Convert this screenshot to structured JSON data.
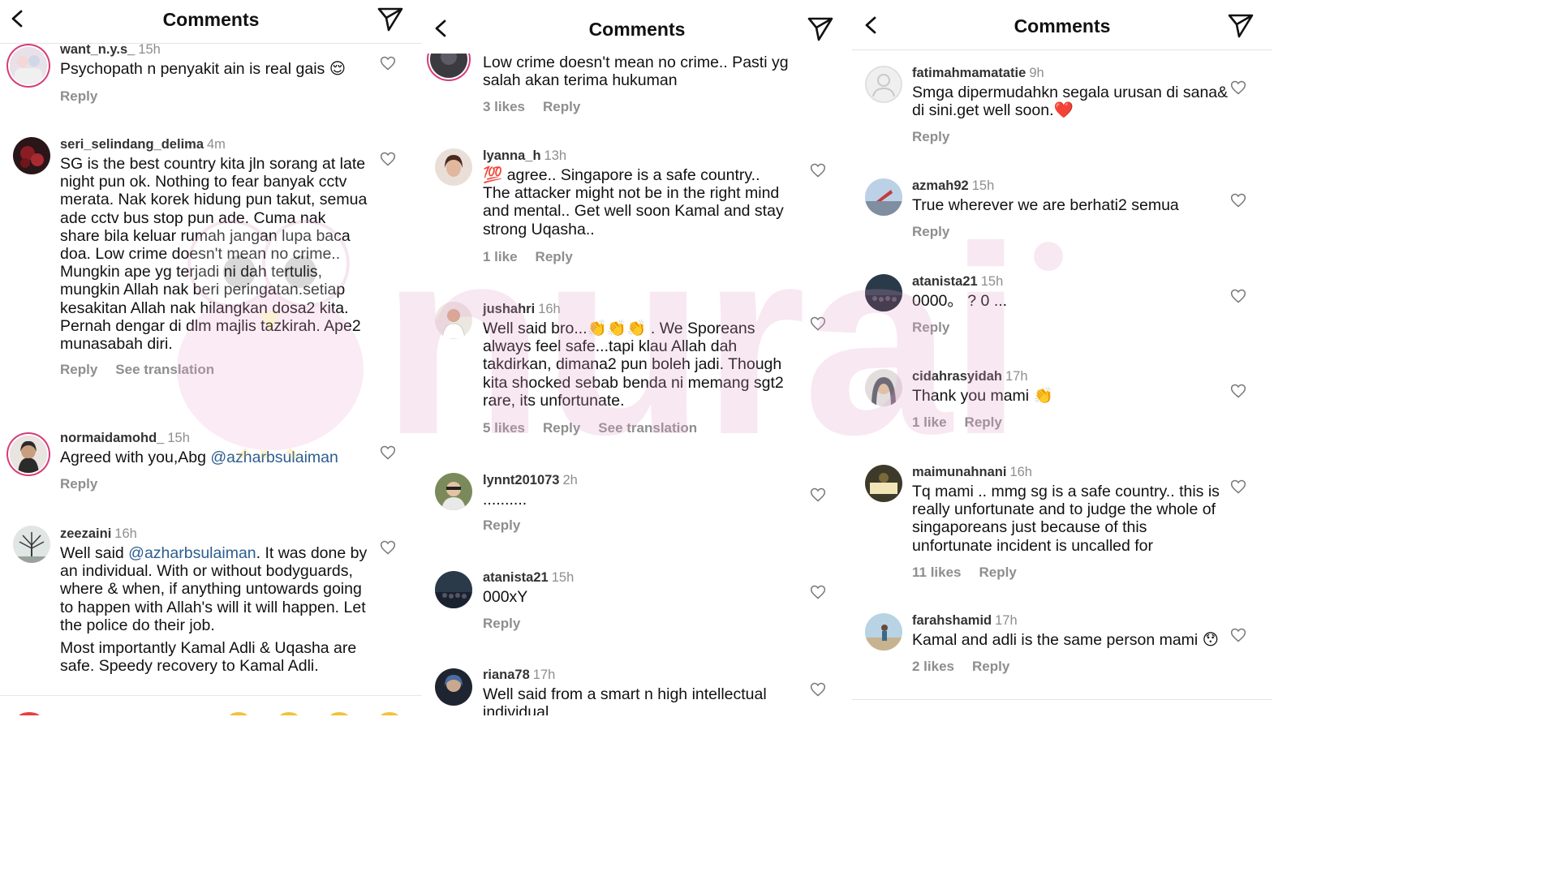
{
  "panels": [
    {
      "title": "Comments",
      "comments": [
        {
          "user": "want_n.y.s_",
          "time": "15h",
          "text": "Psychopath n penyakit ain is real gais 😌",
          "meta": [
            "Reply"
          ]
        },
        {
          "user": "seri_selindang_delima",
          "time": "4m",
          "text": "SG is the best country kita jln sorang at late night pun ok. Nothing to fear banyak cctv merata. Nak korek hidung pun takut, semua ade cctv bus stop pun ade. Cuma nak share bila keluar rumah jangan lupa baca doa. Low crime doesn't mean no crime.. Mungkin ape yg terjadi ni dah tertulis, mungkin Allah nak beri peringatan.setiap kesakitan Allah nak hilangkan dosa2 kita. Pernah dengar di dlm majlis tazkirah. Ape2 munasabah diri.",
          "meta": [
            "Reply",
            "See translation"
          ]
        },
        {
          "user": "normaidamohd_",
          "time": "15h",
          "text_before": "Agreed with you,Abg ",
          "mention": "@azharbsulaiman",
          "meta": [
            "Reply"
          ]
        },
        {
          "user": "zeezaini",
          "time": "16h",
          "text_before": "Well said ",
          "mention": "@azharbsulaiman",
          "text_after": ". It was done by an individual. With or without bodyguards, where & when, if anything untowards going to happen with Allah's will it will happen. Let the police do their job.",
          "text2": "Most importantly Kamal Adli & Uqasha are safe. Speedy recovery to Kamal Adli."
        }
      ]
    },
    {
      "title": "Comments",
      "comments": [
        {
          "text": "Low crime doesn't mean no crime.. Pasti yg salah akan terima hukuman",
          "meta": [
            "3 likes",
            "Reply"
          ]
        },
        {
          "user": "lyanna_h",
          "time": "13h",
          "text": "💯 agree.. Singapore is a safe country.. The attacker might not be in the right mind and mental.. Get well soon Kamal and stay strong Uqasha..",
          "meta": [
            "1 like",
            "Reply"
          ]
        },
        {
          "user": "jushahri",
          "time": "16h",
          "text": "Well said bro...👏👏👏 . We Sporeans always feel safe...tapi klau Allah dah takdirkan, dimana2 pun boleh jadi. Though kita shocked sebab benda ni memang sgt2 rare, its unfortunate.",
          "meta": [
            "5 likes",
            "Reply",
            "See translation"
          ]
        },
        {
          "user": "lynnt201073",
          "time": "2h",
          "text": "..........",
          "meta": [
            "Reply"
          ]
        },
        {
          "user": "atanista21",
          "time": "15h",
          "text": "000xY",
          "meta": [
            "Reply"
          ]
        },
        {
          "user": "riana78",
          "time": "17h",
          "text": "Well said from a smart n high intellectual individual"
        }
      ]
    },
    {
      "title": "Comments",
      "comments": [
        {
          "user": "fatimahmamatatie",
          "time": "9h",
          "text": "Smga dipermudahkn segala urusan di sana& di sini.get well soon.❤️",
          "meta": [
            "Reply"
          ]
        },
        {
          "user": "azmah92",
          "time": "15h",
          "text": "True wherever we are berhati2 semua",
          "meta": [
            "Reply"
          ]
        },
        {
          "user": "atanista21",
          "time": "15h",
          "text": "0000。 ? 0 ...",
          "meta": [
            "Reply"
          ]
        },
        {
          "user": "cidahrasyidah",
          "time": "17h",
          "text": "Thank you mami 👏",
          "meta": [
            "1 like",
            "Reply"
          ]
        },
        {
          "user": "maimunahnani",
          "time": "16h",
          "text": "Tq mami .. mmg sg is a safe country.. this is really unfortunate and to judge the whole of singaporeans just because of this unfortunate incident is uncalled for",
          "meta": [
            "11 likes",
            "Reply"
          ]
        },
        {
          "user": "farahshamid",
          "time": "17h",
          "text": "Kamal and adli is the same person mami 😯",
          "meta": [
            "2 likes",
            "Reply"
          ]
        }
      ]
    }
  ],
  "watermark": "nurai",
  "colors": {
    "ring": "#d63c7a",
    "mention": "#2c5d8f",
    "muted": "#8e8e8e"
  }
}
